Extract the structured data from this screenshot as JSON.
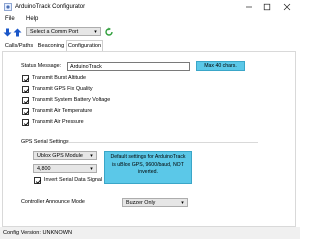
{
  "window": {
    "title": "ArduinoTrack Configurator",
    "controls": [
      "minimize",
      "maximize",
      "close"
    ]
  },
  "menu": {
    "items": [
      "File",
      "Help"
    ]
  },
  "toolbar": {
    "comm_port_placeholder": "Select a Comm Port"
  },
  "tabs": [
    {
      "label": "Calls/Paths",
      "selected": false
    },
    {
      "label": "Beaconing",
      "selected": false
    },
    {
      "label": "Configuration",
      "selected": true
    }
  ],
  "config": {
    "status_message_label": "Status Message:",
    "status_message_value": "ArduinoTrack",
    "status_note": "Max 40 chars.",
    "transmit_options": [
      {
        "label": "Transmit Burst Altitude",
        "checked": true
      },
      {
        "label": "Transmit GPS Fix Quality",
        "checked": true
      },
      {
        "label": "Transmit System Battery Voltage",
        "checked": true
      },
      {
        "label": "Transmit Air Temperature",
        "checked": true
      },
      {
        "label": "Transmit Air Pressure",
        "checked": true
      }
    ],
    "gps_group_label": "GPS Serial Settings",
    "gps_module": "Ublox GPS Module",
    "baud_rate": "4,800",
    "invert_label": "Invert Serial Data Signal",
    "invert_checked": true,
    "gps_note": "Default settings for ArduinoTrack is uBlox GPS, 9600/baud, NOT inverted.",
    "announce_label": "Controller Announce Mode",
    "announce_value": "Buzzer Only"
  },
  "status_bar": {
    "text": "Config Version: UNKNOWN"
  },
  "colors": {
    "note_bg": "#5bc8e8",
    "arrow_blue": "#1a56c8",
    "refresh_green": "#2e9e3a"
  }
}
